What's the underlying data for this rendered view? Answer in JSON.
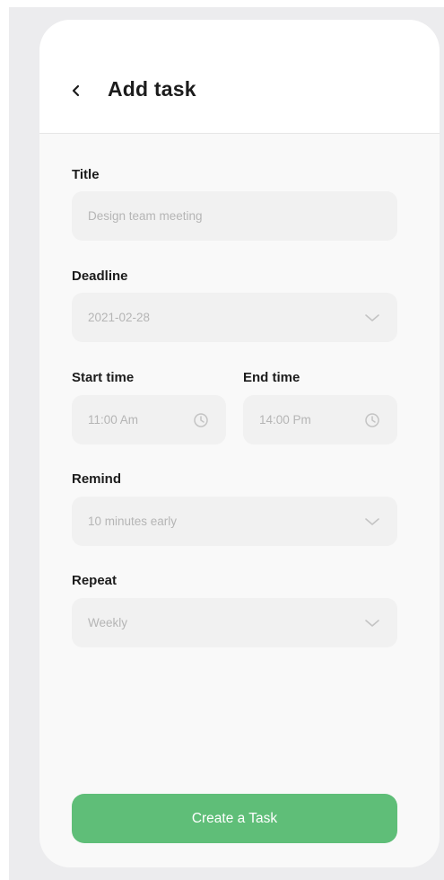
{
  "header": {
    "title": "Add task"
  },
  "form": {
    "title": {
      "label": "Title",
      "placeholder": "Design team meeting"
    },
    "deadline": {
      "label": "Deadline",
      "value": "2021-02-28"
    },
    "start_time": {
      "label": "Start time",
      "value": "11:00 Am"
    },
    "end_time": {
      "label": "End time",
      "value": "14:00 Pm"
    },
    "remind": {
      "label": "Remind",
      "value": "10 minutes early"
    },
    "repeat": {
      "label": "Repeat",
      "value": "Weekly"
    }
  },
  "actions": {
    "create_label": "Create a Task"
  },
  "icons": {
    "back": "chevron-left-icon",
    "dropdown": "chevron-down-icon",
    "time": "clock-icon"
  },
  "colors": {
    "accent": "#5fbe78",
    "field_bg": "#f1f1f1",
    "placeholder": "#b5b5b5"
  }
}
